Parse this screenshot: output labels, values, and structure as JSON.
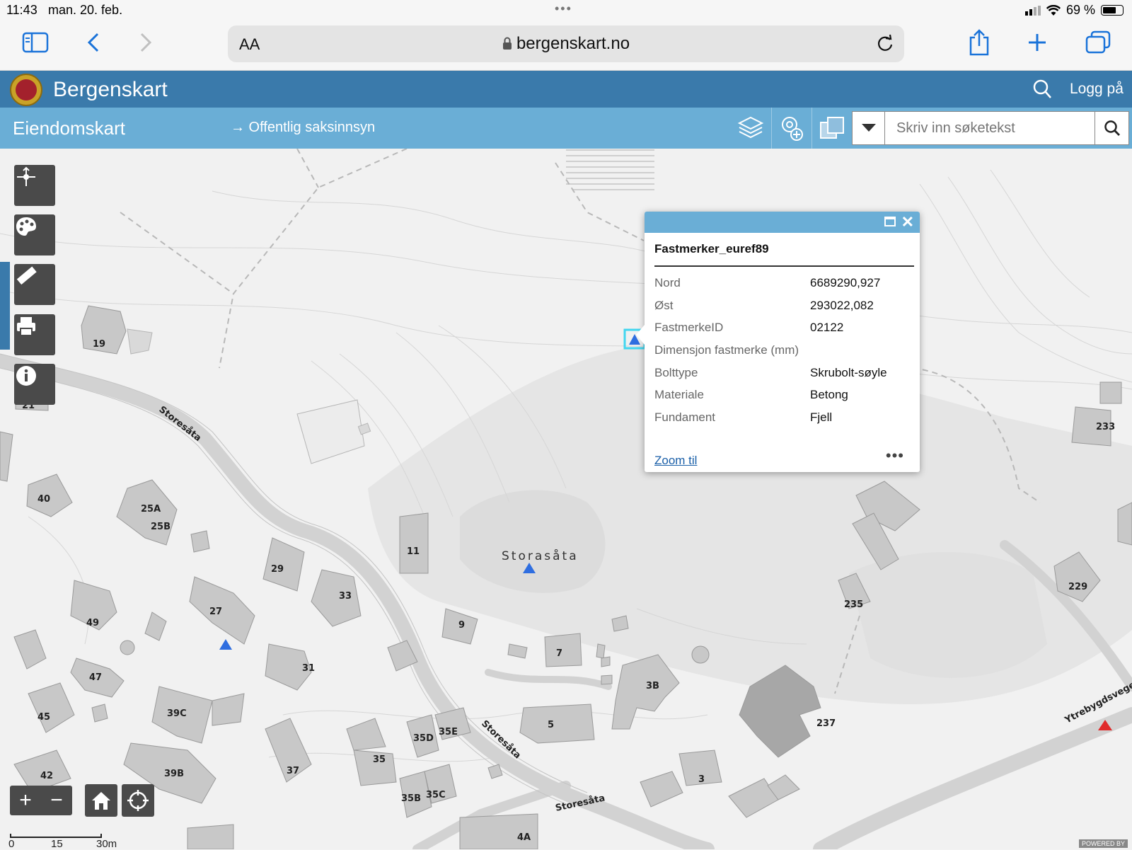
{
  "status": {
    "time": "11:43",
    "date": "man. 20. feb.",
    "battery": "69 %"
  },
  "browser": {
    "url": "bergenskart.no",
    "aa": "AA"
  },
  "header": {
    "title": "Bergenskart",
    "login": "Logg på"
  },
  "subbar": {
    "title": "Eiendomskart",
    "link": "→ Offentlig saksinnsyn",
    "search_placeholder": "Skriv inn søketekst"
  },
  "popup": {
    "title": "Fastmerker_euref89",
    "rows": [
      {
        "key": "Nord",
        "value": "6689290,927"
      },
      {
        "key": "Øst",
        "value": "293022,082"
      },
      {
        "key": "FastmerkeID",
        "value": "02122"
      },
      {
        "key": "Dimensjon fastmerke (mm)",
        "value": ""
      },
      {
        "key": "Bolttype",
        "value": "Skrubolt-søyle"
      },
      {
        "key": "Materiale",
        "value": "Betong"
      },
      {
        "key": "Fundament",
        "value": "Fjell"
      }
    ],
    "zoom_link": "Zoom til",
    "more": "•••"
  },
  "map": {
    "place_name": "Storasåta",
    "road_labels": [
      "Storesåta",
      "Storesåta",
      "Storesåta",
      "Ytrebygdsvege"
    ],
    "house_labels": [
      "19",
      "21",
      "40",
      "25A",
      "25B",
      "29",
      "27",
      "33",
      "11",
      "49",
      "9",
      "7",
      "31",
      "47",
      "45",
      "39C",
      "3B",
      "5",
      "35D",
      "35E",
      "35",
      "37",
      "39B",
      "42",
      "35B",
      "35C",
      "3",
      "4A",
      "237",
      "235",
      "229",
      "233"
    ],
    "scale": {
      "s0": "0",
      "s1": "15",
      "s2": "30m"
    },
    "powered": "POWERED BY"
  }
}
